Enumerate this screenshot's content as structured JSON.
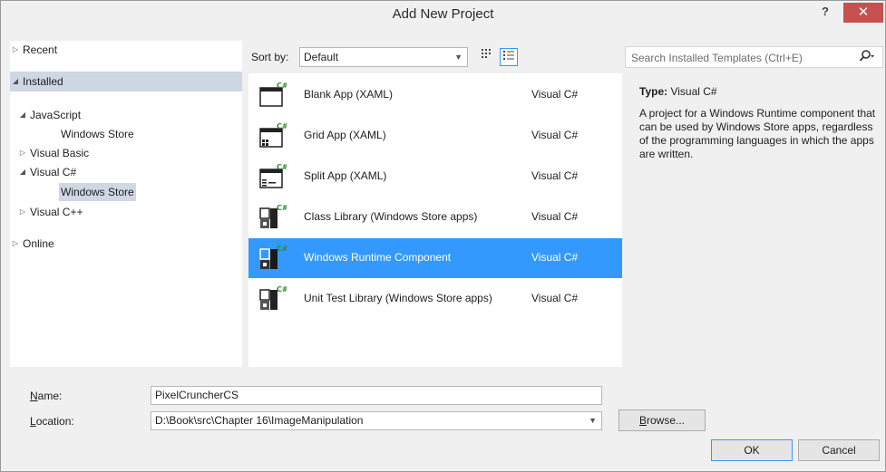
{
  "window": {
    "title": "Add New Project",
    "help_label": "?",
    "close_label": "✕"
  },
  "tree": {
    "recent": "Recent",
    "installed": "Installed",
    "javascript": "JavaScript",
    "javascript_windows_store": "Windows Store",
    "visual_basic": "Visual Basic",
    "visual_csharp": "Visual C#",
    "visual_csharp_windows_store": "Windows Store",
    "visual_cpp": "Visual C++",
    "online": "Online"
  },
  "toolbar": {
    "sort_label": "Sort by:",
    "sort_value": "Default"
  },
  "search": {
    "placeholder": "Search Installed Templates (Ctrl+E)"
  },
  "templates": [
    {
      "name": "Blank App (XAML)",
      "language": "Visual C#",
      "icon": "blank-app-icon"
    },
    {
      "name": "Grid App (XAML)",
      "language": "Visual C#",
      "icon": "grid-app-icon"
    },
    {
      "name": "Split App (XAML)",
      "language": "Visual C#",
      "icon": "split-app-icon"
    },
    {
      "name": "Class Library (Windows Store apps)",
      "language": "Visual C#",
      "icon": "class-library-icon"
    },
    {
      "name": "Windows Runtime Component",
      "language": "Visual C#",
      "icon": "runtime-component-icon"
    },
    {
      "name": "Unit Test Library (Windows Store apps)",
      "language": "Visual C#",
      "icon": "unit-test-icon"
    }
  ],
  "selected_template_index": 4,
  "description": {
    "type_label": "Type:",
    "type_value": "Visual C#",
    "text": "A project for a Windows Runtime component that can be used by Windows Store apps, regardless of the programming languages in which the apps are written."
  },
  "form": {
    "name_label_u": "N",
    "name_label_rest": "ame:",
    "name_value": "PixelCruncherCS",
    "location_label_u": "L",
    "location_label_rest": "ocation:",
    "location_value": "D:\\Book\\src\\Chapter 16\\ImageManipulation",
    "browse_label_u": "B",
    "browse_label_rest": "rowse...",
    "ok_label": "OK",
    "cancel_label": "Cancel"
  },
  "colors": {
    "selection": "#3399ff",
    "tree_selection": "#cfd6e4",
    "close_button": "#c75050"
  }
}
